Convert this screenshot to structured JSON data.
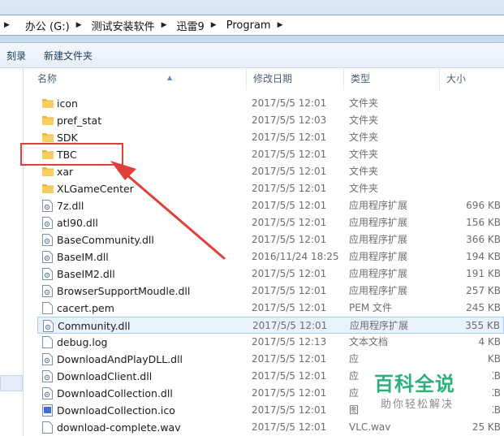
{
  "address_bar": {
    "breadcrumbs": [
      "办公 (G:)",
      "测试安装软件",
      "迅雷9",
      "Program"
    ]
  },
  "toolbar": {
    "burn_label": "刻录",
    "new_folder_label": "新建文件夹"
  },
  "columns": {
    "name": "名称",
    "date": "修改日期",
    "type": "类型",
    "size": "大小"
  },
  "files": [
    {
      "name": "icon",
      "date": "2017/5/5 12:01",
      "type": "文件夹",
      "size": "",
      "kind": "folder"
    },
    {
      "name": "pref_stat",
      "date": "2017/5/5 12:03",
      "type": "文件夹",
      "size": "",
      "kind": "folder"
    },
    {
      "name": "SDK",
      "date": "2017/5/5 12:01",
      "type": "文件夹",
      "size": "",
      "kind": "folder"
    },
    {
      "name": "TBC",
      "date": "2017/5/5 12:01",
      "type": "文件夹",
      "size": "",
      "kind": "folder"
    },
    {
      "name": "xar",
      "date": "2017/5/5 12:01",
      "type": "文件夹",
      "size": "",
      "kind": "folder"
    },
    {
      "name": "XLGameCenter",
      "date": "2017/5/5 12:01",
      "type": "文件夹",
      "size": "",
      "kind": "folder"
    },
    {
      "name": "7z.dll",
      "date": "2017/5/5 12:01",
      "type": "应用程序扩展",
      "size": "696 KB",
      "kind": "dll"
    },
    {
      "name": "atl90.dll",
      "date": "2017/5/5 12:01",
      "type": "应用程序扩展",
      "size": "156 KB",
      "kind": "dll"
    },
    {
      "name": "BaseCommunity.dll",
      "date": "2017/5/5 12:01",
      "type": "应用程序扩展",
      "size": "366 KB",
      "kind": "dll"
    },
    {
      "name": "BaseIM.dll",
      "date": "2016/11/24 18:25",
      "type": "应用程序扩展",
      "size": "194 KB",
      "kind": "dll"
    },
    {
      "name": "BaseIM2.dll",
      "date": "2017/5/5 12:01",
      "type": "应用程序扩展",
      "size": "191 KB",
      "kind": "dll"
    },
    {
      "name": "BrowserSupportMoudle.dll",
      "date": "2017/5/5 12:01",
      "type": "应用程序扩展",
      "size": "257 KB",
      "kind": "dll"
    },
    {
      "name": "cacert.pem",
      "date": "2017/5/5 12:01",
      "type": "PEM 文件",
      "size": "245 KB",
      "kind": "file"
    },
    {
      "name": "Community.dll",
      "date": "2017/5/5 12:01",
      "type": "应用程序扩展",
      "size": "355 KB",
      "kind": "dll",
      "selected": true
    },
    {
      "name": "debug.log",
      "date": "2017/5/5 12:13",
      "type": "文本文档",
      "size": "4 KB",
      "kind": "file"
    },
    {
      "name": "DownloadAndPlayDLL.dll",
      "date": "2017/5/5 12:01",
      "type": "应",
      "size": "KB",
      "kind": "dll"
    },
    {
      "name": "DownloadClient.dll",
      "date": "2017/5/5 12:01",
      "type": "应",
      "size": "KB",
      "kind": "dll"
    },
    {
      "name": "DownloadCollection.dll",
      "date": "2017/5/5 12:01",
      "type": "应",
      "size": "KB",
      "kind": "dll"
    },
    {
      "name": "DownloadCollection.ico",
      "date": "2017/5/5 12:01",
      "type": "图",
      "size": "KB",
      "kind": "ico"
    },
    {
      "name": "download-complete.wav",
      "date": "2017/5/5 12:01",
      "type": "VLC.wav",
      "size": "25 KB",
      "kind": "file"
    }
  ],
  "watermark": {
    "title": "百科全说",
    "subtitle": "助你轻松解决"
  },
  "colors": {
    "highlight_box": "#e0403a",
    "watermark_green": "#2bb27a",
    "folder_yellow": "#f3c64f"
  }
}
